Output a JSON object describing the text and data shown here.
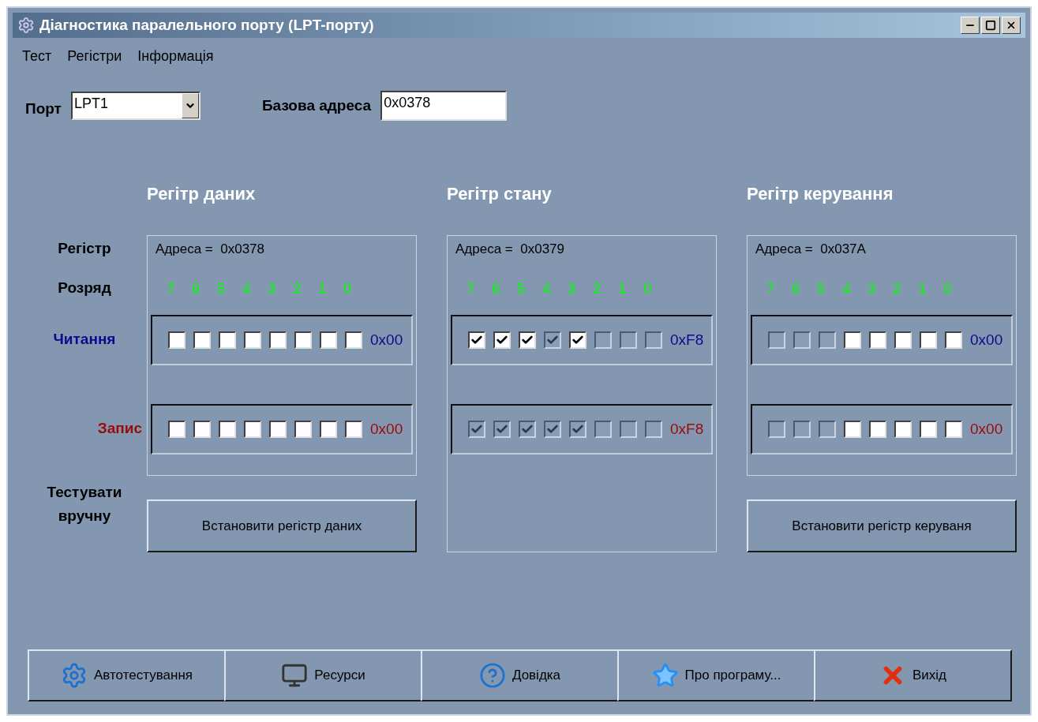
{
  "window": {
    "title": "Діагностика паралельного порту (LPT-порту)"
  },
  "menu": [
    "Тест",
    "Регістри",
    "Інформація"
  ],
  "port": {
    "label": "Порт",
    "value": "LPT1"
  },
  "base_address": {
    "label": "Базова адреса",
    "value": "0x0378"
  },
  "row_labels": {
    "register": "Регістр",
    "bit": "Розряд",
    "read": "Читання",
    "write": "Запис",
    "manual": "Тестувати вручну"
  },
  "registers": [
    {
      "title": "Регітр даних",
      "address": "Адреса =  0x0378",
      "bits": [
        "7",
        "6",
        "5",
        "4",
        "3",
        "2",
        "1",
        "0"
      ],
      "read": {
        "value": "0x00",
        "bits": [
          {
            "checked": false,
            "disabled": false
          },
          {
            "checked": false,
            "disabled": false
          },
          {
            "checked": false,
            "disabled": false
          },
          {
            "checked": false,
            "disabled": false
          },
          {
            "checked": false,
            "disabled": false
          },
          {
            "checked": false,
            "disabled": false
          },
          {
            "checked": false,
            "disabled": false
          },
          {
            "checked": false,
            "disabled": false
          }
        ]
      },
      "write": {
        "value": "0x00",
        "bits": [
          {
            "checked": false,
            "disabled": false
          },
          {
            "checked": false,
            "disabled": false
          },
          {
            "checked": false,
            "disabled": false
          },
          {
            "checked": false,
            "disabled": false
          },
          {
            "checked": false,
            "disabled": false
          },
          {
            "checked": false,
            "disabled": false
          },
          {
            "checked": false,
            "disabled": false
          },
          {
            "checked": false,
            "disabled": false
          }
        ]
      },
      "button": "Встановити регістр даних"
    },
    {
      "title": "Регітр стану",
      "address": "Адреса =  0x0379",
      "bits": [
        "7",
        "6",
        "5",
        "4",
        "3",
        "2",
        "1",
        "0"
      ],
      "read": {
        "value": "0xF8",
        "bits": [
          {
            "checked": true,
            "disabled": false
          },
          {
            "checked": true,
            "disabled": false
          },
          {
            "checked": true,
            "disabled": false
          },
          {
            "checked": true,
            "disabled": true
          },
          {
            "checked": true,
            "disabled": false
          },
          {
            "checked": false,
            "disabled": true
          },
          {
            "checked": false,
            "disabled": true
          },
          {
            "checked": false,
            "disabled": true
          }
        ]
      },
      "write": {
        "value": "0xF8",
        "bits": [
          {
            "checked": true,
            "disabled": true
          },
          {
            "checked": true,
            "disabled": true
          },
          {
            "checked": true,
            "disabled": true
          },
          {
            "checked": true,
            "disabled": true
          },
          {
            "checked": true,
            "disabled": true
          },
          {
            "checked": false,
            "disabled": true
          },
          {
            "checked": false,
            "disabled": true
          },
          {
            "checked": false,
            "disabled": true
          }
        ]
      }
    },
    {
      "title": "Регітр керування",
      "address": "Адреса =  0x037A",
      "bits": [
        "7",
        "6",
        "5",
        "4",
        "3",
        "2",
        "1",
        "0"
      ],
      "read": {
        "value": "0x00",
        "bits": [
          {
            "checked": false,
            "disabled": true
          },
          {
            "checked": false,
            "disabled": true
          },
          {
            "checked": false,
            "disabled": true
          },
          {
            "checked": false,
            "disabled": false
          },
          {
            "checked": false,
            "disabled": false
          },
          {
            "checked": false,
            "disabled": false
          },
          {
            "checked": false,
            "disabled": false
          },
          {
            "checked": false,
            "disabled": false
          }
        ]
      },
      "write": {
        "value": "0x00",
        "bits": [
          {
            "checked": false,
            "disabled": true
          },
          {
            "checked": false,
            "disabled": true
          },
          {
            "checked": false,
            "disabled": true
          },
          {
            "checked": false,
            "disabled": false
          },
          {
            "checked": false,
            "disabled": false
          },
          {
            "checked": false,
            "disabled": false
          },
          {
            "checked": false,
            "disabled": false
          },
          {
            "checked": false,
            "disabled": false
          }
        ]
      },
      "button": "Встановити регістр керуваня"
    }
  ],
  "buttons": [
    {
      "label": "Автотестування",
      "kind": "gear"
    },
    {
      "label": "Ресурси",
      "kind": "monitor"
    },
    {
      "label": "Довідка",
      "kind": "help"
    },
    {
      "label": "Про програму...",
      "kind": "star"
    },
    {
      "label": "Вихід",
      "kind": "exit"
    }
  ]
}
